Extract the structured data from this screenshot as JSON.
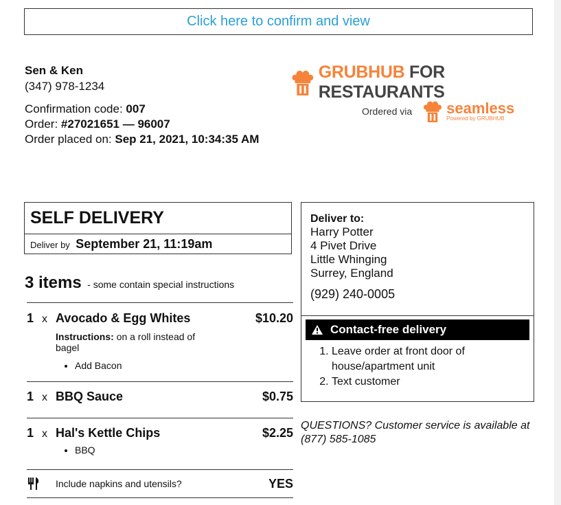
{
  "confirm": {
    "label": "Click here to confirm and view"
  },
  "restaurant": {
    "name": "Sen & Ken",
    "phone": "(347) 978-1234"
  },
  "order": {
    "confirmation_label": "Confirmation code: ",
    "confirmation_code": "007",
    "order_label": "Order: ",
    "order_number": "#27021651 — 96007",
    "placed_label": "Order placed on: ",
    "placed_value": "Sep 21, 2021, 10:34:35 AM"
  },
  "branding": {
    "grubhub_word": "GRUBHUB",
    "for_restaurants": "FOR RESTAURANTS",
    "ordered_via": "Ordered via",
    "seamless": "seamless",
    "powered_by": "Powered by GRUBHUB",
    "accent_color": "#f6833a"
  },
  "delivery": {
    "type": "SELF DELIVERY",
    "deliver_by_label": "Deliver by",
    "deliver_by_value": "September 21, 11:19am"
  },
  "items_summary": {
    "count": "3 items",
    "note": "- some contain special instructions"
  },
  "items": [
    {
      "qty": "1",
      "x": "x",
      "name": "Avocado & Egg Whites",
      "price": "$10.20",
      "instructions_label": "Instructions:",
      "instructions": " on a roll instead of bagel",
      "modifiers": [
        "Add Bacon"
      ]
    },
    {
      "qty": "1",
      "x": "x",
      "name": "BBQ Sauce",
      "price": "$0.75"
    },
    {
      "qty": "1",
      "x": "x",
      "name": "Hal's Kettle Chips",
      "price": "$2.25",
      "modifiers": [
        "BBQ"
      ]
    }
  ],
  "utensils": {
    "label": "Include napkins and utensils?",
    "value": "YES",
    "icon": "utensils-icon"
  },
  "customer": {
    "deliver_to_label": "Deliver to:",
    "name": "Harry Potter",
    "address1": "4 Pivet Drive",
    "address2": "Little Whinging",
    "address3": "Surrey, England",
    "phone": "(929) 240-0005"
  },
  "contact_free": {
    "title": "Contact-free delivery",
    "icon": "warning-icon",
    "steps": [
      "Leave order at front door of house/apartment unit",
      "Text customer"
    ]
  },
  "questions": {
    "text": "QUESTIONS? Customer service is available at (877) 585-1085"
  }
}
